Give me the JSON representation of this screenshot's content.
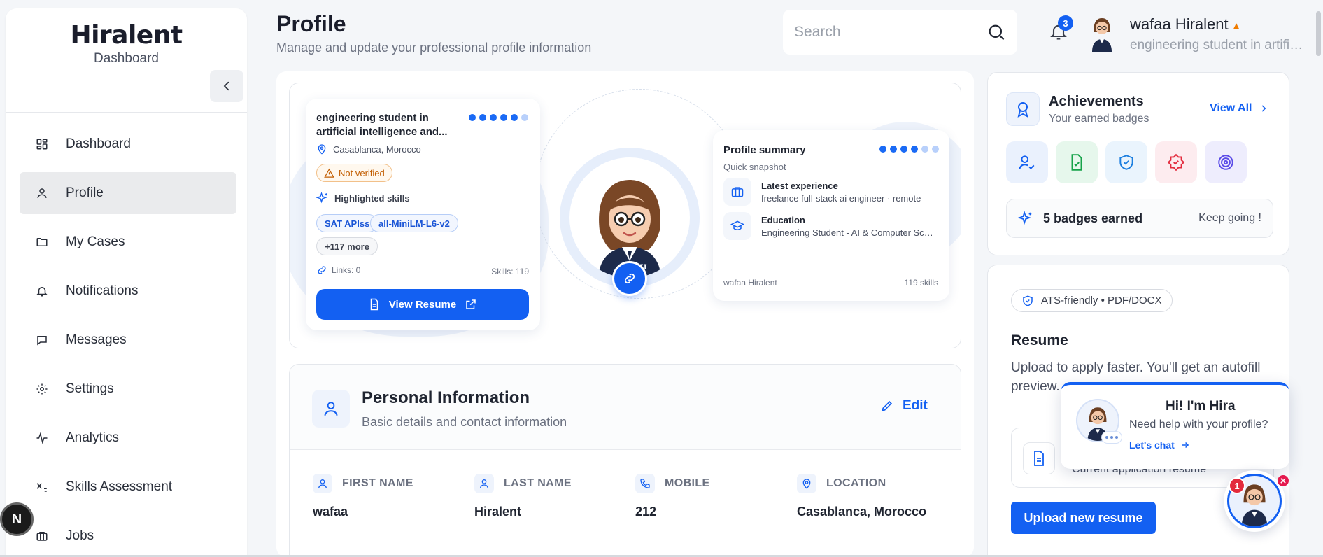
{
  "brand": {
    "logo": "Hiralent",
    "sub": "Dashboard"
  },
  "nav": [
    {
      "label": "Dashboard",
      "icon": "dashboard-icon"
    },
    {
      "label": "Profile",
      "icon": "user-icon",
      "active": true
    },
    {
      "label": "My Cases",
      "icon": "folder-icon"
    },
    {
      "label": "Notifications",
      "icon": "bell-icon"
    },
    {
      "label": "Messages",
      "icon": "message-icon"
    },
    {
      "label": "Settings",
      "icon": "gear-icon"
    },
    {
      "label": "Analytics",
      "icon": "activity-icon"
    },
    {
      "label": "Skills Assessment",
      "icon": "subscript-icon"
    },
    {
      "label": "Jobs",
      "icon": "briefcase-icon"
    }
  ],
  "n_badge": "N",
  "header": {
    "title": "Profile",
    "subtitle": "Manage and update your professional profile information",
    "search_placeholder": "Search",
    "notification_count": "3",
    "user_name": "wafaa Hiralent",
    "user_role": "engineering student in artificial intelligence and..."
  },
  "hero": {
    "left_card": {
      "title": "engineering student in artificial intelligence and...",
      "location": "Casablanca, Morocco",
      "status": "Not verified",
      "skills_heading": "Highlighted skills",
      "skills": [
        "SAT APIss",
        "all-MiniLM-L6-v2"
      ],
      "more": "+117 more",
      "links": "Links: 0",
      "skills_count": "Skills: 119",
      "button": "View Resume"
    },
    "right_card": {
      "title": "Profile summary",
      "subtitle": "Quick snapshot",
      "experience_label": "Latest experience",
      "experience_value": "freelance full-stack ai engineer · remote",
      "education_label": "Education",
      "education_value": "Engineering Student - AI & Computer Science",
      "footer_name": "wafaa Hiralent",
      "footer_skills": "119 skills"
    }
  },
  "personal": {
    "title": "Personal Information",
    "subtitle": "Basic details and contact information",
    "edit": "Edit",
    "fields": [
      {
        "label": "First Name",
        "value": "wafaa"
      },
      {
        "label": "Last Name",
        "value": "Hiralent"
      },
      {
        "label": "Mobile",
        "value": "212"
      },
      {
        "label": "Location",
        "value": "Casablanca, Morocco"
      }
    ]
  },
  "achievements": {
    "title": "Achievements",
    "subtitle": "Your earned badges",
    "view_all": "View All",
    "earned": "5 badges earned",
    "encourage": "Keep going !",
    "badge_colors": [
      "#eaf1fd",
      "#e6f7ec",
      "#eaf4fd",
      "#fdecef",
      "#eeedfd"
    ]
  },
  "resume": {
    "ats": "ATS-friendly • PDF/DOCX",
    "title": "Resume",
    "subtitle": "Upload to apply faster. You'll get an autofill preview.",
    "file_label": "Current application resume",
    "button": "Upload new resume"
  },
  "chat": {
    "title": "Hi! I'm Hira",
    "subtitle": "Need help with your profile?",
    "link": "Let's chat",
    "count": "1"
  },
  "colors": {
    "primary": "#1360f2",
    "warning": "#f07c00",
    "danger": "#e32b3d"
  }
}
